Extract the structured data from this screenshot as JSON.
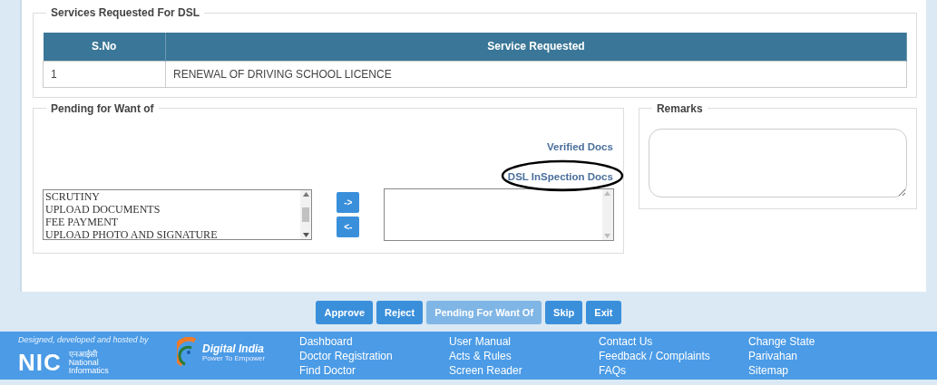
{
  "services": {
    "legend": "Services Requested For DSL",
    "columns": [
      "S.No",
      "Service Requested"
    ],
    "rows": [
      [
        "1",
        "RENEWAL OF DRIVING SCHOOL LICENCE"
      ]
    ]
  },
  "pending": {
    "legend": "Pending for Want of",
    "links": [
      "Verified Docs",
      "DSL InSpection Docs"
    ],
    "available": [
      "SCRUTINY",
      "UPLOAD DOCUMENTS",
      "FEE PAYMENT",
      "UPLOAD PHOTO AND SIGNATURE"
    ],
    "move_right": "->",
    "move_left": "<-"
  },
  "remarks": {
    "legend": "Remarks"
  },
  "actions": [
    {
      "label": "Approve",
      "disabled": false
    },
    {
      "label": "Reject",
      "disabled": false
    },
    {
      "label": "Pending For Want Of",
      "disabled": true
    },
    {
      "label": "Skip",
      "disabled": false
    },
    {
      "label": "Exit",
      "disabled": false
    }
  ],
  "footer": {
    "credit": "Designed, developed and hosted by",
    "nic": {
      "mark": "NIC",
      "hindi": "एनआईसी",
      "name_lines": [
        "National",
        "Informatics"
      ]
    },
    "digital_india": {
      "title": "Digital India",
      "tagline": "Power To Empower"
    },
    "link_columns": [
      [
        "Dashboard",
        "Doctor Registration",
        "Find Doctor"
      ],
      [
        "User Manual",
        "Acts & Rules",
        "Screen Reader"
      ],
      [
        "Contact Us",
        "Feedback / Complaints",
        "FAQs"
      ],
      [
        "Change State",
        "Parivahan",
        "Sitemap"
      ]
    ]
  }
}
